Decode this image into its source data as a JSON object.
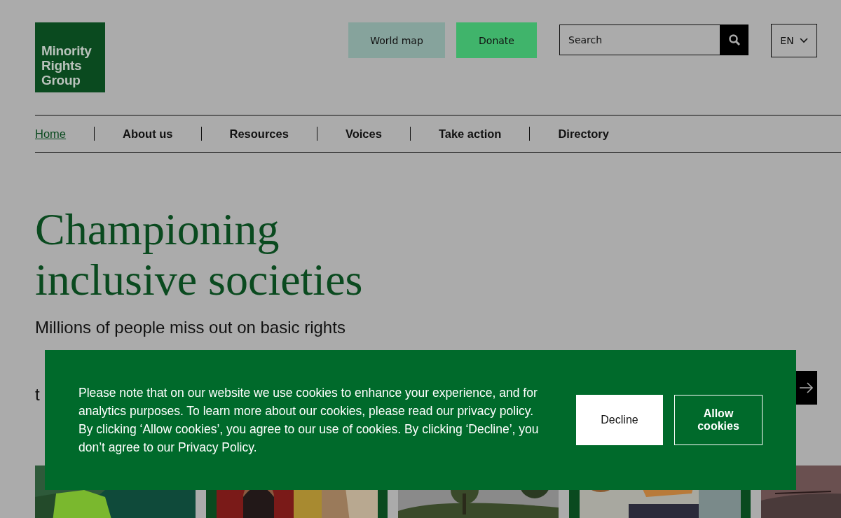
{
  "logo": {
    "lines": [
      "Minority",
      "Rights",
      "Group"
    ]
  },
  "header_buttons": [
    {
      "label": "World map",
      "kind": "secondary"
    },
    {
      "label": "Donate",
      "kind": "primary"
    }
  ],
  "search": {
    "placeholder": "Search"
  },
  "language": {
    "label": "EN"
  },
  "nav": [
    {
      "label": "Home",
      "selected": true
    },
    {
      "label": "About us",
      "selected": false
    },
    {
      "label": "Resources",
      "selected": false
    },
    {
      "label": "Voices",
      "selected": false
    },
    {
      "label": "Take action",
      "selected": false
    },
    {
      "label": "Directory",
      "selected": false
    }
  ],
  "hero": {
    "title_lines": [
      "Championing",
      "inclusive societies"
    ],
    "text_lines": [
      "Millions of people miss out on basic rights",
      "t"
    ]
  },
  "cards": [
    {
      "kind": "picture",
      "framed": false
    },
    {
      "kind": "picture",
      "framed": true
    },
    {
      "kind": "picture",
      "framed": false
    },
    {
      "kind": "picture",
      "framed": true
    },
    {
      "kind": "picture",
      "framed": false
    }
  ],
  "cookie_banner": {
    "text": "Please note that on our website we use cookies to enhance your experience, and for analytics purposes. To learn more about our cookies, please read our privacy policy. By clicking ‘Allow cookies’, you agree to our use of cookies. By clicking ‘Decline’, you don’t agree to our Privacy Policy.",
    "buttons": [
      {
        "label": "Decline",
        "kind": "filled"
      },
      {
        "label": "Allow cookies",
        "kind": "outline"
      }
    ]
  }
}
